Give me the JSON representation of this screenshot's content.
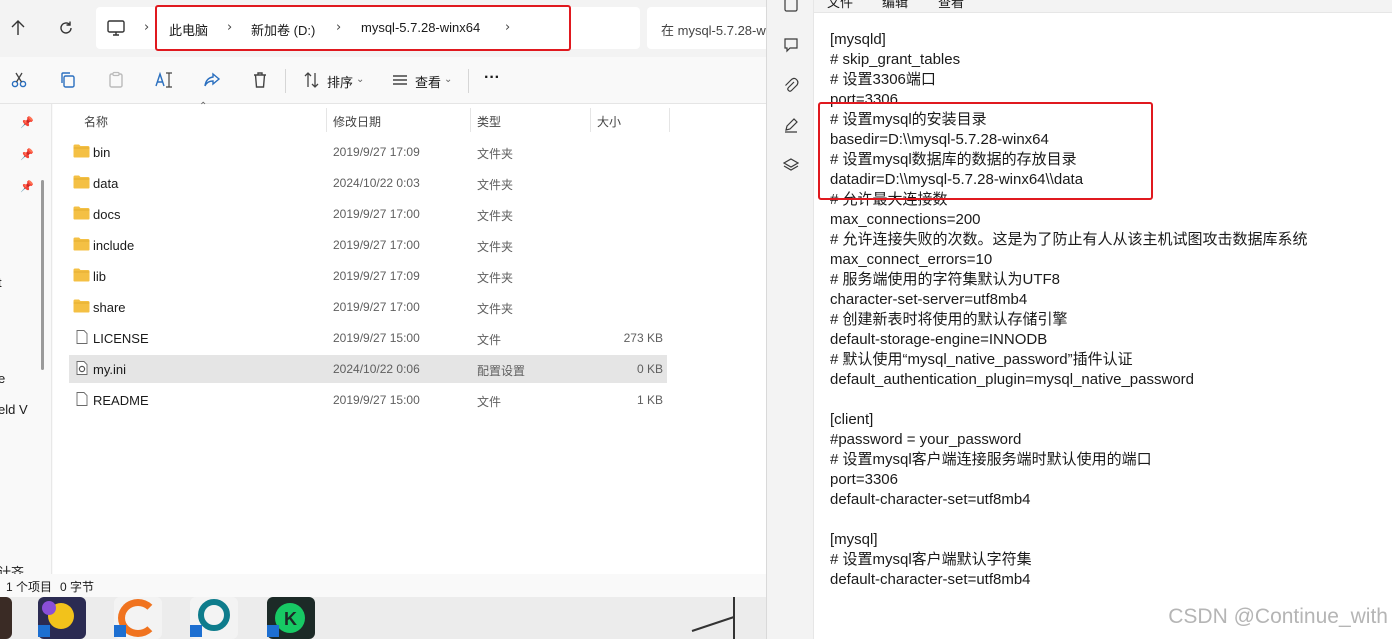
{
  "explorer": {
    "breadcrumb": [
      "此电脑",
      "新加卷 (D:)",
      "mysql-5.7.28-winx64"
    ],
    "search_placeholder": "在 mysql-5.7.28-w",
    "toolbar": {
      "sort_label": "排序",
      "view_label": "查看",
      "more_label": "···"
    },
    "columns": {
      "name": "名称",
      "date": "修改日期",
      "type": "类型",
      "size": "大小"
    },
    "files": [
      {
        "name": "bin",
        "date": "2019/9/27 17:09",
        "type": "文件夹",
        "size": "",
        "kind": "folder"
      },
      {
        "name": "data",
        "date": "2024/10/22 0:03",
        "type": "文件夹",
        "size": "",
        "kind": "folder"
      },
      {
        "name": "docs",
        "date": "2019/9/27 17:00",
        "type": "文件夹",
        "size": "",
        "kind": "folder"
      },
      {
        "name": "include",
        "date": "2019/9/27 17:00",
        "type": "文件夹",
        "size": "",
        "kind": "folder"
      },
      {
        "name": "lib",
        "date": "2019/9/27 17:09",
        "type": "文件夹",
        "size": "",
        "kind": "folder"
      },
      {
        "name": "share",
        "date": "2019/9/27 17:00",
        "type": "文件夹",
        "size": "",
        "kind": "folder"
      },
      {
        "name": "LICENSE",
        "date": "2019/9/27 15:00",
        "type": "文件",
        "size": "273 KB",
        "kind": "file"
      },
      {
        "name": "my.ini",
        "date": "2024/10/22 0:06",
        "type": "配置设置",
        "size": "0 KB",
        "kind": "ini",
        "selected": true
      },
      {
        "name": "README",
        "date": "2019/9/27 15:00",
        "type": "文件",
        "size": "1 KB",
        "kind": "file"
      }
    ],
    "left_pane_fragments": [
      "t",
      "e",
      "eld V",
      "计齐"
    ],
    "status": {
      "items": "1 个项目",
      "bytes": "0 字节"
    }
  },
  "notepad": {
    "menu": [
      "文件",
      "编辑",
      "查看"
    ],
    "lines": [
      "[mysqld]",
      "# skip_grant_tables",
      "# 设置3306端口",
      "port=3306",
      "# 设置mysql的安装目录",
      "basedir=D:\\\\mysql-5.7.28-winx64",
      "# 设置mysql数据库的数据的存放目录",
      "datadir=D:\\\\mysql-5.7.28-winx64\\\\data",
      "# 允许最大连接数",
      "max_connections=200",
      "# 允许连接失败的次数。这是为了防止有人从该主机试图攻击数据库系统",
      "max_connect_errors=10",
      "# 服务端使用的字符集默认为UTF8",
      "character-set-server=utf8mb4",
      "# 创建新表时将使用的默认存储引擎",
      "default-storage-engine=INNODB",
      "# 默认使用“mysql_native_password”插件认证",
      "default_authentication_plugin=mysql_native_password",
      "",
      "[client]",
      "#password = your_password",
      "# 设置mysql客户端连接服务端时默认使用的端口",
      "port=3306",
      "default-character-set=utf8mb4",
      "",
      "[mysql]",
      "# 设置mysql客户端默认字符集",
      "default-character-set=utf8mb4"
    ]
  },
  "watermark": "CSDN @Continue_with",
  "colors": {
    "highlight_red": "#e0191f",
    "folder_yellow": "#f4c044",
    "selection_gray": "#e5e5e5"
  }
}
